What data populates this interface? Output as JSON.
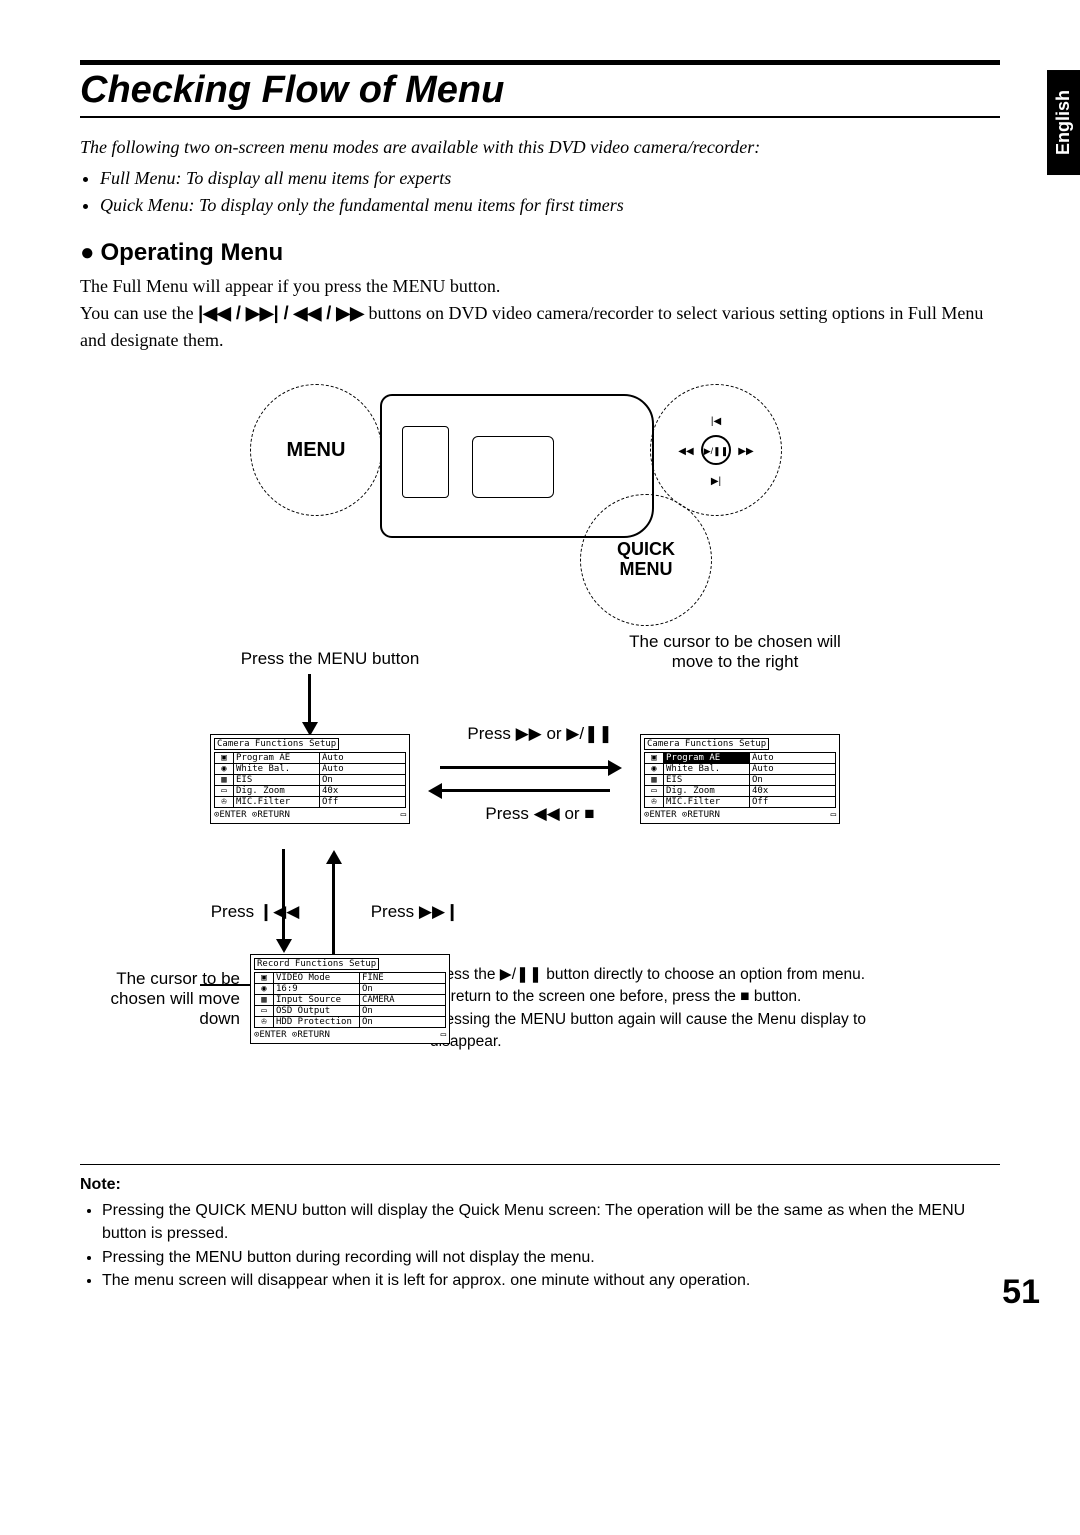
{
  "language_tab": "English",
  "title": "Checking Flow of Menu",
  "intro_line": "The following two on-screen menu modes are available with this DVD video camera/recorder:",
  "intro_bullets": [
    "Full Menu: To display all menu items for experts",
    "Quick Menu: To display only the fundamental menu items for first timers"
  ],
  "subheading": "Operating Menu",
  "body_text_1": "The Full Menu will appear if you press the MENU button.",
  "body_text_2_part1": "You can use the ",
  "body_text_2_part2": " buttons on DVD video camera/recorder to select various setting options in Full Menu and designate them.",
  "nav_symbols": "◂◂ / ▸▸ / ◀◀ / ▶▶",
  "dial_menu": "MENU",
  "dial_quick": "QUICK\nMENU",
  "captions": {
    "press_menu": "Press the MENU button",
    "cursor_right": "The cursor to be chosen will move to the right",
    "press_next": "Press ▶▶ or ▶/❚❚",
    "press_prev": "Press ◀◀ or ■",
    "press_fwd": "Press ▶▶❙",
    "press_back": "Press ❙◀◀",
    "cursor_down": "The cursor to be chosen will move down",
    "bottom_text": "Press the ▶/❚❚ button directly to choose an option from menu.\nTo return to the screen one before, press the ■ button.\nPressing the MENU button again will cause the Menu display to disappear."
  },
  "osd": {
    "camera_setup": {
      "title": "Camera Functions Setup",
      "rows": [
        {
          "icon": "▣",
          "label": "Program AE",
          "value": "Auto"
        },
        {
          "icon": "◉",
          "label": "White Bal.",
          "value": "Auto"
        },
        {
          "icon": "▦",
          "label": "EIS",
          "value": "On"
        },
        {
          "icon": "▭",
          "label": "Dig. Zoom",
          "value": "40x"
        },
        {
          "icon": "✇",
          "label": "MIC.Filter",
          "value": "Off"
        }
      ],
      "footer_left": "⊙ENTER  ⊙RETURN"
    },
    "record_setup": {
      "title": "Record Functions Setup",
      "rows": [
        {
          "icon": "▣",
          "label": "VIDEO Mode",
          "value": "FINE"
        },
        {
          "icon": "◉",
          "label": "16:9",
          "value": "On"
        },
        {
          "icon": "▦",
          "label": "Input Source",
          "value": "CAMERA"
        },
        {
          "icon": "▭",
          "label": "OSD Output",
          "value": "On"
        },
        {
          "icon": "✇",
          "label": "HDD Protection",
          "value": "On"
        }
      ],
      "footer_left": "⊙ENTER  ⊙RETURN"
    }
  },
  "note": {
    "label": "Note:",
    "items": [
      "Pressing the QUICK MENU button will display the Quick Menu screen: The operation will be the same as when the MENU button is pressed.",
      "Pressing the MENU button during recording will not display the menu.",
      "The menu screen will disappear when it is left for approx. one minute without any operation."
    ]
  },
  "page_number": "51"
}
